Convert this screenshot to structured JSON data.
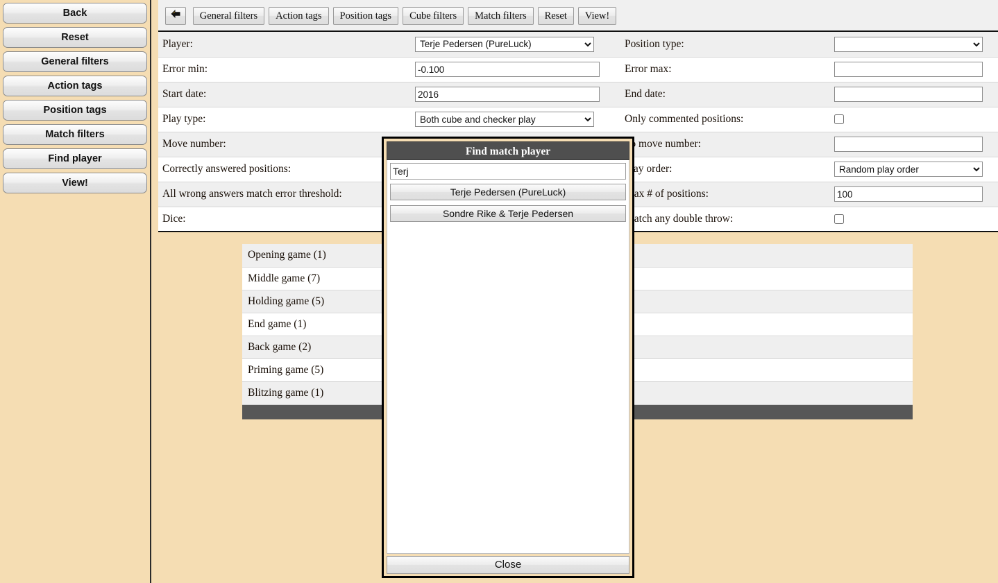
{
  "sidebar": {
    "buttons": [
      {
        "label": "Back",
        "name": "back"
      },
      {
        "label": "Reset",
        "name": "reset"
      },
      {
        "label": "General filters",
        "name": "general-filters"
      },
      {
        "label": "Action tags",
        "name": "action-tags"
      },
      {
        "label": "Position tags",
        "name": "position-tags"
      },
      {
        "label": "Match filters",
        "name": "match-filters"
      },
      {
        "label": "Find player",
        "name": "find-player"
      },
      {
        "label": "View!",
        "name": "view"
      }
    ]
  },
  "toolbar": {
    "back_icon": "left-arrow-icon",
    "buttons": [
      {
        "label": "General filters"
      },
      {
        "label": "Action tags"
      },
      {
        "label": "Position tags"
      },
      {
        "label": "Cube filters"
      },
      {
        "label": "Match filters"
      },
      {
        "label": "Reset"
      },
      {
        "label": "View!"
      }
    ]
  },
  "filters": {
    "rows": [
      {
        "left_label": "Player:",
        "left_type": "select",
        "left_value": "Terje Pedersen (PureLuck)",
        "right_label": "Position type:",
        "right_type": "select",
        "right_value": ""
      },
      {
        "left_label": "Error min:",
        "left_type": "text",
        "left_value": "-0.100",
        "right_label": "Error max:",
        "right_type": "text",
        "right_value": ""
      },
      {
        "left_label": "Start date:",
        "left_type": "text",
        "left_value": "2016",
        "right_label": "End date:",
        "right_type": "text",
        "right_value": ""
      },
      {
        "left_label": "Play type:",
        "left_type": "select",
        "left_value": "Both cube and checker play",
        "right_label": "Only commented positions:",
        "right_type": "checkbox",
        "right_value": ""
      },
      {
        "left_label": "Move number:",
        "left_type": "text",
        "left_value": "",
        "right_label": "To move number:",
        "right_type": "text",
        "right_value": ""
      },
      {
        "left_label": "Correctly answered positions:",
        "left_type": "select",
        "left_value": "",
        "right_label": "Play order:",
        "right_type": "select",
        "right_value": "Random play order"
      },
      {
        "left_label": "All wrong answers match error threshold:",
        "left_type": "checkbox",
        "left_value": "",
        "right_label": "Max # of positions:",
        "right_type": "text",
        "right_value": "100"
      },
      {
        "left_label": "Dice:",
        "left_type": "text",
        "left_value": "",
        "right_label": "Match any double throw:",
        "right_type": "checkbox",
        "right_value": ""
      }
    ]
  },
  "tags": {
    "rows": [
      {
        "label": "Opening game (1)"
      },
      {
        "label": "Middle game (7)"
      },
      {
        "label": "Holding game (5)"
      },
      {
        "label": "End game (1)"
      },
      {
        "label": "Back game (2)"
      },
      {
        "label": "Priming game (5)"
      },
      {
        "label": "Blitzing game (1)"
      }
    ]
  },
  "dialog": {
    "title": "Find match player",
    "search_value": "Terj",
    "search_placeholder": "",
    "results": [
      {
        "label": "Terje Pedersen (PureLuck)"
      },
      {
        "label": "Sondre Rike & Terje Pedersen"
      }
    ],
    "close_label": "Close"
  },
  "colors": {
    "page_background": "#f5ddb3",
    "row_alt": "#efefef",
    "dark_bar": "#575757",
    "dialog_title_bg": "#4f4f4f"
  }
}
